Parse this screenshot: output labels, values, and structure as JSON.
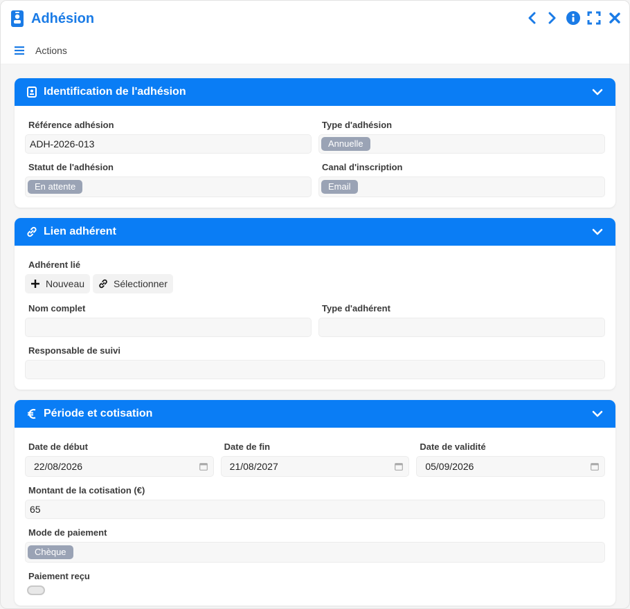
{
  "window": {
    "title": "Adhésion",
    "icons": [
      "id-badge-icon",
      "chevron-left-icon",
      "chevron-right-icon",
      "info-icon",
      "fullscreen-icon",
      "close-icon"
    ]
  },
  "toolbar": {
    "actions_label": "Actions"
  },
  "colors": {
    "accent": "#0a7df5",
    "title": "#1a7be6",
    "badge": "#9aa3b5"
  },
  "identification": {
    "title": "Identification de l'adhésion",
    "reference_label": "Référence adhésion",
    "reference_value": "ADH-2026-013",
    "type_label": "Type d'adhésion",
    "type_value": "Annuelle",
    "statut_label": "Statut de l'adhésion",
    "statut_value": "En attente",
    "canal_label": "Canal d'inscription",
    "canal_value": "Email"
  },
  "lien": {
    "title": "Lien adhérent",
    "adherent_label": "Adhérent lié",
    "new_label": "Nouveau",
    "select_label": "Sélectionner",
    "nom_label": "Nom complet",
    "nom_value": "",
    "type_label": "Type d'adhérent",
    "type_value": "",
    "responsable_label": "Responsable de suivi",
    "responsable_value": ""
  },
  "periode": {
    "title": "Période et cotisation",
    "debut_label": "Date de début",
    "debut_value": "22/08/2026",
    "fin_label": "Date de fin",
    "fin_value": "21/08/2027",
    "validite_label": "Date de validité",
    "validite_value": "05/09/2026",
    "montant_label": "Montant de la cotisation (€)",
    "montant_value": "65",
    "mode_label": "Mode de paiement",
    "mode_value": "Chèque",
    "recu_label": "Paiement reçu"
  }
}
